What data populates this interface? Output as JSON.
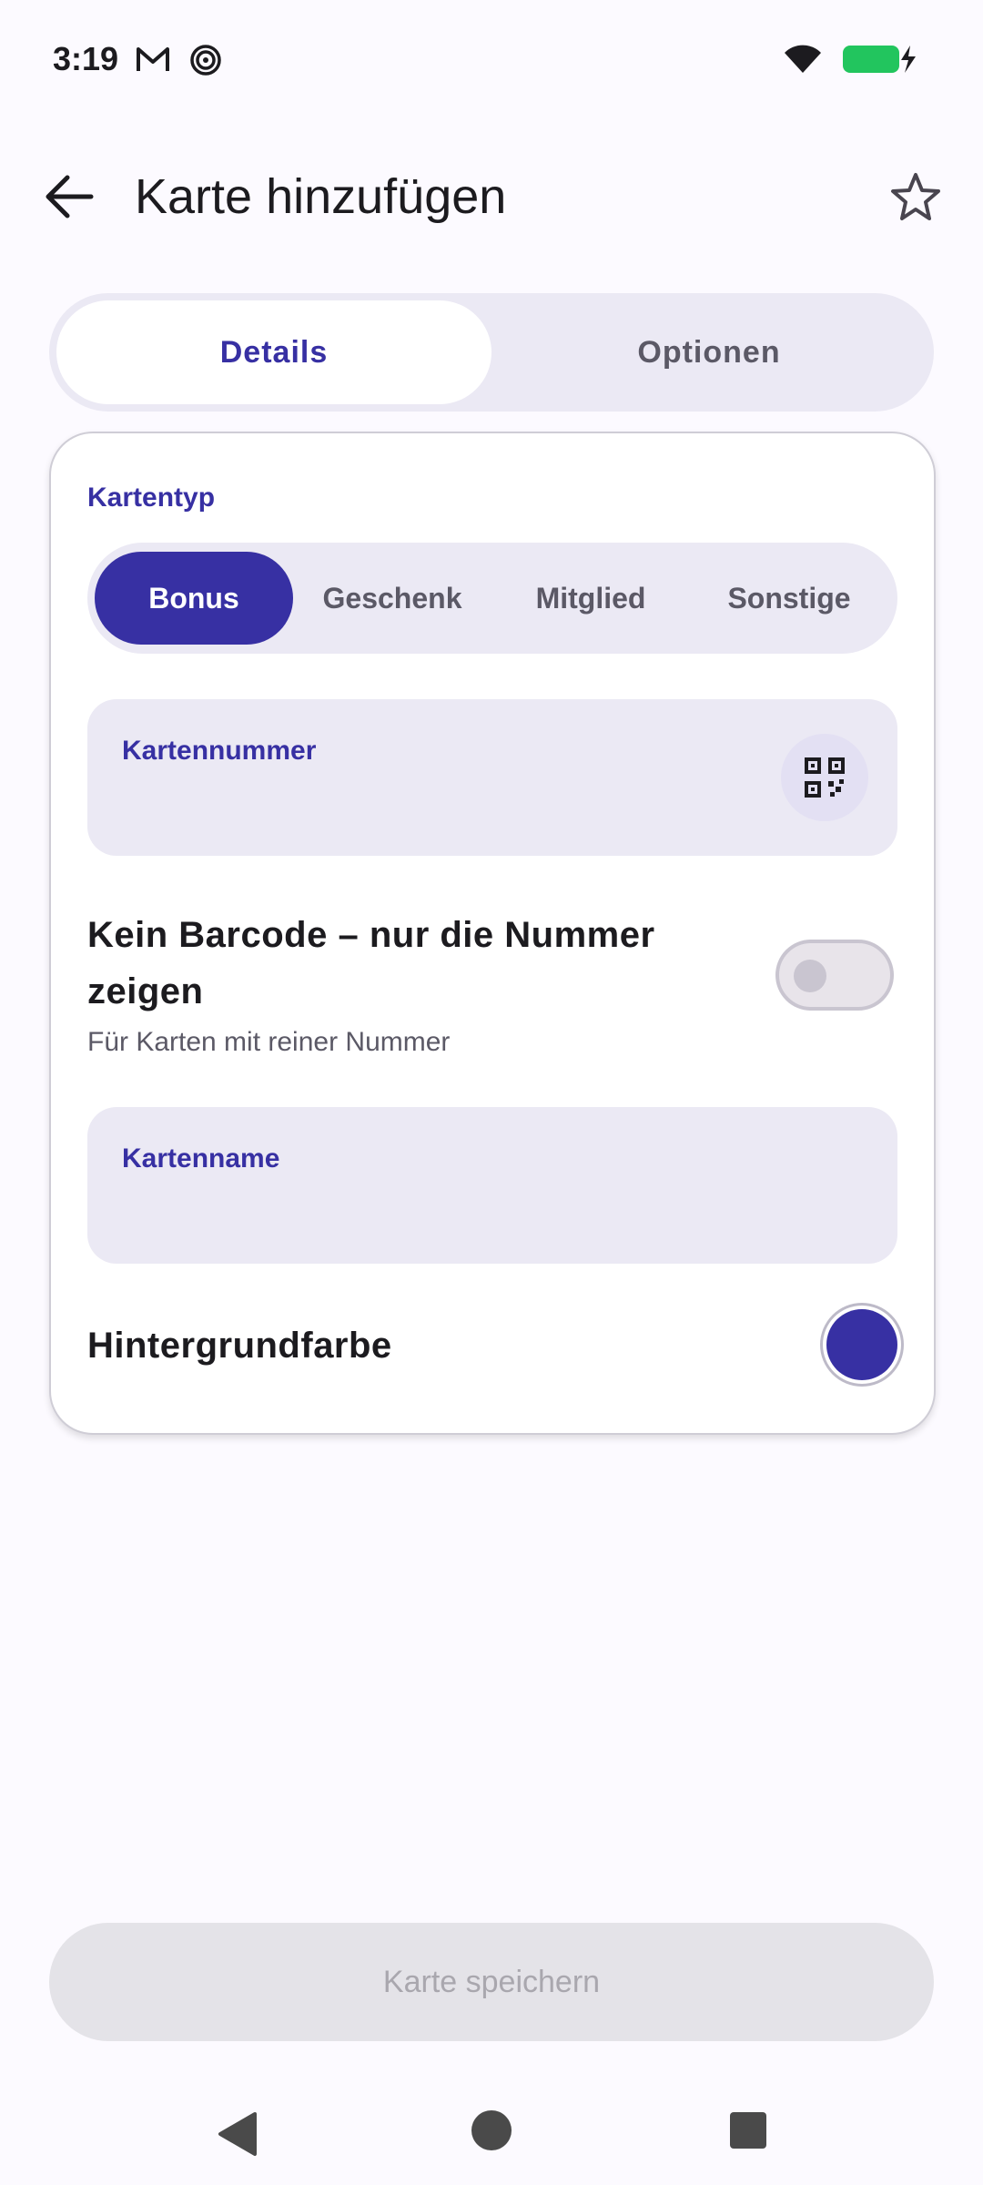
{
  "status_bar": {
    "time": "3:19",
    "icons": [
      "gmail-icon",
      "spiral-icon",
      "wifi-icon",
      "battery-charging-icon"
    ],
    "battery_color": "#22c55e"
  },
  "app_bar": {
    "title": "Karte hinzufügen",
    "back_icon": "arrow-back-icon",
    "favorite_icon": "star-outline-icon"
  },
  "tabs": [
    {
      "label": "Details",
      "selected": true
    },
    {
      "label": "Optionen",
      "selected": false
    }
  ],
  "card": {
    "card_type": {
      "label": "Kartentyp",
      "options": [
        {
          "label": "Bonus",
          "selected": true
        },
        {
          "label": "Geschenk",
          "selected": false
        },
        {
          "label": "Mitglied",
          "selected": false
        },
        {
          "label": "Sonstige",
          "selected": false
        }
      ]
    },
    "card_number": {
      "label": "Kartennummer",
      "value": "",
      "scan_icon": "qr-scan-icon"
    },
    "no_barcode": {
      "title": "Kein Barcode – nur die Nummer zeigen",
      "subtitle": "Für Karten mit reiner Nummer",
      "enabled": false
    },
    "card_name": {
      "label": "Kartenname",
      "value": ""
    },
    "background_color": {
      "label": "Hintergrundfarbe",
      "color": "#3730a3"
    }
  },
  "save_button": {
    "label": "Karte speichern",
    "enabled": false
  },
  "colors": {
    "accent": "#3730a3",
    "surface_variant": "#ebe9f4",
    "background": "#fcfaff"
  }
}
